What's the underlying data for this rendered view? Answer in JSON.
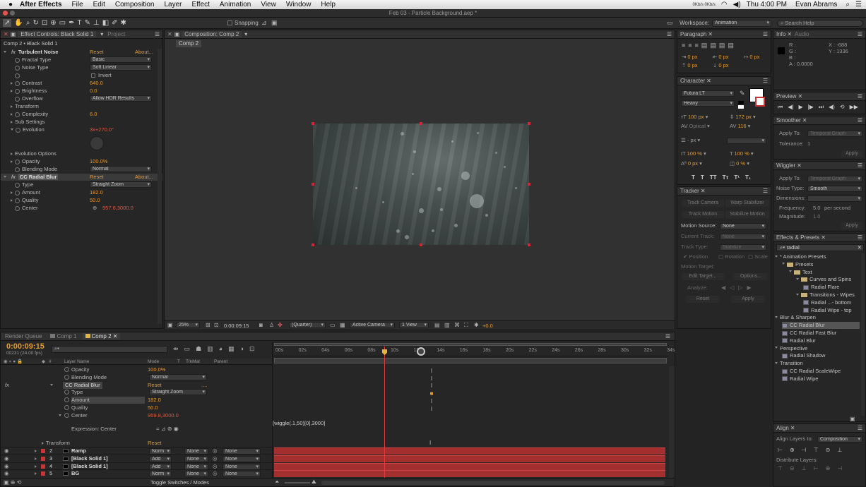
{
  "menubar": {
    "app": "After Effects",
    "items": [
      "File",
      "Edit",
      "Composition",
      "Layer",
      "Effect",
      "Animation",
      "View",
      "Window",
      "Help"
    ],
    "clock": "Thu 4:00 PM",
    "user": "Evan Abrams",
    "hud": "0Kb/s 0Kb/s"
  },
  "titlebar": {
    "title": "Feb 03 - Particle Background.aep *"
  },
  "toolbar": {
    "snapping": "Snapping",
    "workspace_label": "Workspace:",
    "workspace": "Animation",
    "search": "Search Help"
  },
  "effect_controls": {
    "tab": "Effect Controls: Black Solid 1",
    "tab2": "Project",
    "breadcrumb": "Comp 2 • Black Solid 1",
    "rows": [
      {
        "label": "Turbulent Noise",
        "kind": "fx",
        "reset": "Reset",
        "about": "About..."
      },
      {
        "label": "Fractal Type",
        "dd": "Basic"
      },
      {
        "label": "Noise Type",
        "dd": "Soft Linear"
      },
      {
        "label": "",
        "check": "Invert"
      },
      {
        "label": "Contrast",
        "value": "640.0"
      },
      {
        "label": "Brightness",
        "value": "0.0"
      },
      {
        "label": "Overflow",
        "dd": "Allow HDR Results"
      },
      {
        "label": "Transform",
        "kind": "group"
      },
      {
        "label": "Complexity",
        "value": "6.0"
      },
      {
        "label": "Sub Settings",
        "kind": "group"
      },
      {
        "label": "Evolution",
        "value": "3x+270.0°",
        "red": true
      }
    ],
    "rows2": [
      {
        "label": "Evolution Options",
        "kind": "group"
      },
      {
        "label": "Opacity",
        "value": "100.0%"
      },
      {
        "label": "Blending Mode",
        "dd": "Normal"
      },
      {
        "label": "CC Radial Blur",
        "kind": "fx",
        "reset": "Reset",
        "about": "About..."
      },
      {
        "label": "Type",
        "dd": "Straight Zoom"
      },
      {
        "label": "Amount",
        "value": "182.0"
      },
      {
        "label": "Quality",
        "value": "50.0"
      },
      {
        "label": "Center",
        "value": "957.6,3000.0",
        "red": true
      }
    ]
  },
  "composition": {
    "tab": "Composition: Comp 2",
    "subtab": "Comp 2",
    "zoom": "25%",
    "timecode": "0:00:09:15",
    "resolution": "(Quarter)",
    "camera": "Active Camera",
    "views": "1 View",
    "exposure": "+0.0"
  },
  "paragraph": {
    "tab": "Paragraph",
    "fields": [
      "0 px",
      "0 px",
      "0 px",
      "0 px",
      "0 px"
    ]
  },
  "character": {
    "tab": "Character",
    "font": "Futura LT",
    "style": "Heavy",
    "size": "100 px",
    "leading": "172 px",
    "kerning": "Optical",
    "tracking": "116",
    "stroke": "- px",
    "vscale": "100 %",
    "hscale": "100 %",
    "baseline": "0 px",
    "tsume": "0 %",
    "styles": [
      "T",
      "T",
      "TT",
      "Tт",
      "T¹",
      "T₁"
    ]
  },
  "tracker": {
    "tab": "Tracker",
    "track_camera": "Track Camera",
    "warp_stabilizer": "Warp Stabilizer",
    "track_motion": "Track Motion",
    "stabilize_motion": "Stabilize Motion",
    "motion_source_label": "Motion Source:",
    "motion_source": "None",
    "current_track_label": "Current Track:",
    "current_track": "None",
    "track_type_label": "Track Type:",
    "track_type": "Stabilize",
    "position": "Position",
    "rotation": "Rotation",
    "scale": "Scale",
    "motion_target_label": "Motion Target:",
    "edit_target": "Edit Target...",
    "options": "Options...",
    "analyze_label": "Analyze:",
    "reset": "Reset",
    "apply": "Apply"
  },
  "info": {
    "tab": "Info",
    "tab2": "Audio",
    "r": "R :",
    "g": "G :",
    "b": "B :",
    "a": "A : 0.0000",
    "x": "X : -688",
    "y": "Y : 1336"
  },
  "preview": {
    "tab": "Preview"
  },
  "smoother": {
    "tab": "Smoother",
    "apply_to_label": "Apply To:",
    "apply_to": "Temporal Graph",
    "tolerance_label": "Tolerance:",
    "tolerance": "1",
    "apply": "Apply"
  },
  "wiggler": {
    "tab": "Wiggler",
    "apply_to_label": "Apply To:",
    "apply_to": "Temporal Graph",
    "noise_type_label": "Noise Type:",
    "noise_type": "Smooth",
    "dimensions_label": "Dimensions:",
    "frequency_label": "Frequency:",
    "frequency": "5.0",
    "per_second": "per second",
    "magnitude_label": "Magnitude:",
    "magnitude": "1.0",
    "apply": "Apply"
  },
  "effects_presets": {
    "tab": "Effects & Presets",
    "search": "radial",
    "items": [
      {
        "label": "* Animation Presets",
        "level": 0,
        "kind": "group"
      },
      {
        "label": "Presets",
        "level": 1,
        "kind": "folder"
      },
      {
        "label": "Text",
        "level": 2,
        "kind": "folder"
      },
      {
        "label": "Curves and Spins",
        "level": 3,
        "kind": "folder"
      },
      {
        "label": "Radial Flare",
        "level": 4,
        "kind": "fx"
      },
      {
        "label": "Transitions - Wipes",
        "level": 3,
        "kind": "folder"
      },
      {
        "label": "Radial ...- bottom",
        "level": 4,
        "kind": "fx"
      },
      {
        "label": "Radial Wipe - top",
        "level": 4,
        "kind": "fx"
      },
      {
        "label": "Blur & Sharpen",
        "level": 0,
        "kind": "group"
      },
      {
        "label": "CC Radial Blur",
        "level": 1,
        "kind": "fx",
        "selected": true
      },
      {
        "label": "CC Radial Fast Blur",
        "level": 1,
        "kind": "fx"
      },
      {
        "label": "Radial Blur",
        "level": 1,
        "kind": "fx"
      },
      {
        "label": "Perspective",
        "level": 0,
        "kind": "group"
      },
      {
        "label": "Radial Shadow",
        "level": 1,
        "kind": "fx"
      },
      {
        "label": "Transition",
        "level": 0,
        "kind": "group"
      },
      {
        "label": "CC Radial ScaleWipe",
        "level": 1,
        "kind": "fx"
      },
      {
        "label": "Radial Wipe",
        "level": 1,
        "kind": "fx"
      }
    ]
  },
  "align": {
    "tab": "Align",
    "align_to_label": "Align Layers to:",
    "align_to": "Composition",
    "distribute": "Distribute Layers:"
  },
  "timeline": {
    "tabs": [
      "Render Queue",
      "Comp 1",
      "Comp 2"
    ],
    "timecode": "0:00:09:15",
    "frames": "00231 (24.00 fps)",
    "cols": {
      "num": "#",
      "name": "Layer Name",
      "mode": "Mode",
      "t": "T",
      "trkmat": "TrkMat",
      "parent": "Parent"
    },
    "ruler": [
      "00s",
      "02s",
      "04s",
      "06s",
      "08s",
      "10s",
      "12s",
      "14s",
      "16s",
      "18s",
      "20s",
      "22s",
      "24s",
      "26s",
      "28s",
      "30s",
      "32s",
      "34s"
    ],
    "props": [
      {
        "label": "Opacity",
        "value": "100.0%",
        "indent": 90
      },
      {
        "label": "Blending Mode",
        "dd": "Normal",
        "indent": 90
      },
      {
        "label": "CC Radial Blur",
        "reset": "Reset",
        "dots": "....",
        "indent": 78,
        "fx": true
      },
      {
        "label": "Type",
        "dd": "Straight Zoom",
        "indent": 90
      },
      {
        "label": "Amount",
        "value": "182.0",
        "indent": 90,
        "sel": true
      },
      {
        "label": "Quality",
        "value": "50.0",
        "indent": 90
      },
      {
        "label": "Center",
        "value": "959.8,3000.0",
        "indent": 90,
        "red": true
      }
    ],
    "expr_label": "Expression: Center",
    "expression": "[wiggle(.1,50)[0],3000]",
    "transform": "Transform",
    "transform_reset": "Reset",
    "layers": [
      {
        "num": "2",
        "name": "Ramp",
        "mode": "Norm",
        "trk": "None",
        "parent": "None"
      },
      {
        "num": "3",
        "name": "[Black Solid 1]",
        "mode": "Add",
        "trk": "None",
        "parent": "None"
      },
      {
        "num": "4",
        "name": "[Black Solid 1]",
        "mode": "Add",
        "trk": "None",
        "parent": "None"
      },
      {
        "num": "5",
        "name": "BG",
        "mode": "Norm",
        "trk": "None",
        "parent": "None"
      }
    ],
    "toggle": "Toggle Switches / Modes"
  }
}
